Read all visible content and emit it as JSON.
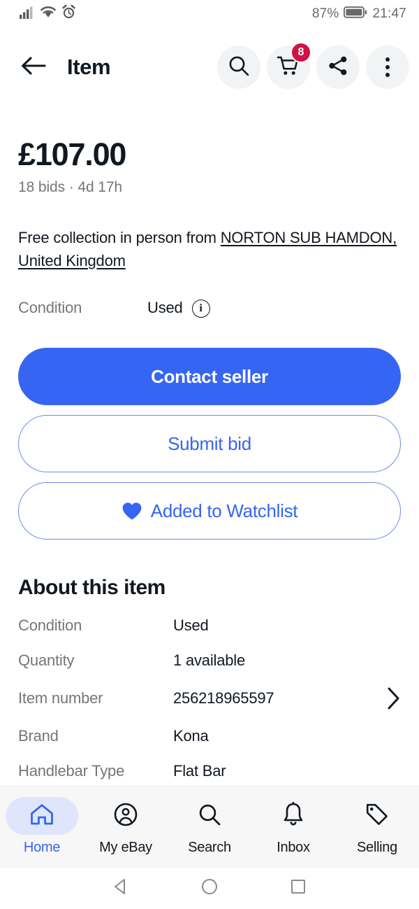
{
  "status_bar": {
    "battery_percent": "87%",
    "time": "21:47",
    "icons": [
      "signal-icon",
      "wifi-icon",
      "alarm-icon",
      "battery-icon"
    ]
  },
  "header": {
    "back_icon": "arrow-left-icon",
    "title": "Item",
    "actions": [
      {
        "name": "search-icon",
        "badge": null
      },
      {
        "name": "cart-icon",
        "badge": "8"
      },
      {
        "name": "share-icon",
        "badge": null
      },
      {
        "name": "overflow-menu-icon",
        "badge": null
      }
    ]
  },
  "listing": {
    "price": "£107.00",
    "bid_info": "18 bids · 4d 17h",
    "shipping_prefix": "Free collection in person from ",
    "shipping_location": "NORTON SUB HAMDON, United Kingdom",
    "condition_label": "Condition",
    "condition_value": "Used",
    "info_icon": "info-icon"
  },
  "actions": {
    "contact_seller": "Contact seller",
    "submit_bid": "Submit bid",
    "watchlist": "Added to Watchlist",
    "watchlist_icon": "heart-filled-icon"
  },
  "about": {
    "heading": "About this item",
    "specs": [
      {
        "key": "Condition",
        "value": "Used",
        "chevron": false
      },
      {
        "key": "Quantity",
        "value": "1 available",
        "chevron": false
      },
      {
        "key": "Item number",
        "value": "256218965597",
        "chevron": true
      },
      {
        "key": "Brand",
        "value": "Kona",
        "chevron": false
      },
      {
        "key": "Handlebar Type",
        "value": "Flat Bar",
        "chevron": false
      }
    ]
  },
  "bottom_nav": {
    "items": [
      {
        "label": "Home",
        "icon": "home-icon",
        "active": true
      },
      {
        "label": "My eBay",
        "icon": "account-circle-icon",
        "active": false
      },
      {
        "label": "Search",
        "icon": "search-icon",
        "active": false
      },
      {
        "label": "Inbox",
        "icon": "bell-icon",
        "active": false
      },
      {
        "label": "Selling",
        "icon": "tag-icon",
        "active": false
      }
    ]
  },
  "system_nav": {
    "back": "triangle-back-icon",
    "home": "circle-home-icon",
    "recents": "square-recents-icon"
  },
  "colors": {
    "accent_blue": "#3665f3",
    "badge_red": "#d01345",
    "muted_text": "#767676",
    "nav_bg": "#f7f7f7",
    "active_pill": "#dfe6fb"
  }
}
